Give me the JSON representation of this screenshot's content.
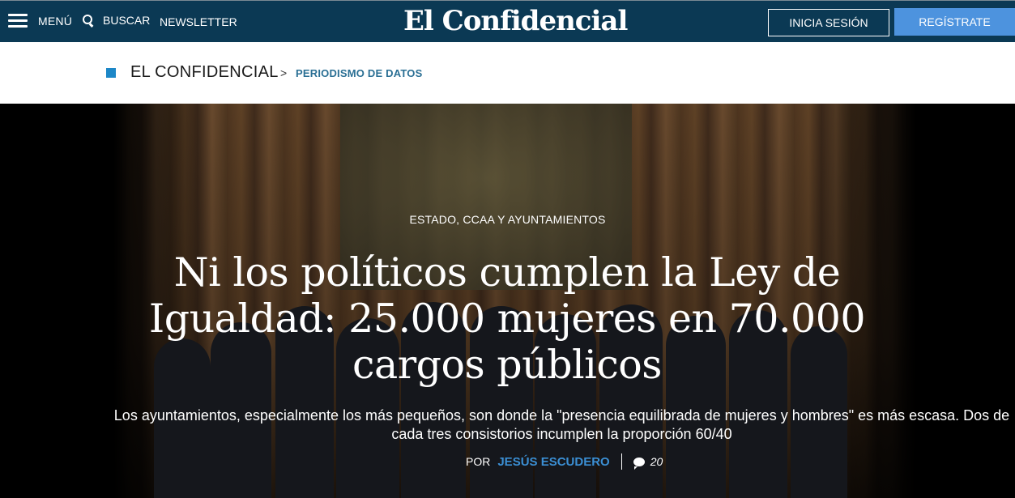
{
  "header": {
    "menu_label": "MENÚ",
    "search_label": "BUSCAR",
    "newsletter_label": "NEWSLETTER",
    "logo_text": "El Confidencial",
    "login_label": "INICIA SESIÓN",
    "register_label": "REGÍSTRATE",
    "colors": {
      "bar": "#0b3954",
      "register_button": "#4d93de"
    }
  },
  "breadcrumb": {
    "home": "EL CONFIDENCIAL",
    "separator": ">",
    "section": "PERIODISMO DE DATOS",
    "colors": {
      "square": "#1d87c7",
      "section": "#2a6f94"
    }
  },
  "article": {
    "category": "ESTADO, CCAA Y AYUNTAMIENTOS",
    "headline": "Ni los políticos cumplen la Ley de Igualdad: 25.000 mujeres en 70.000 cargos públicos",
    "subtitle": "Los ayuntamientos, especialmente los más pequeños, son donde la \"presencia equilibrada de mujeres y hombres\" es más escasa. Dos de cada tres consistorios incumplen la proporción 60/40",
    "byline_prefix": "POR",
    "author": "JESÚS ESCUDERO",
    "comment_count": "20",
    "colors": {
      "author": "#3b8fd4"
    }
  }
}
